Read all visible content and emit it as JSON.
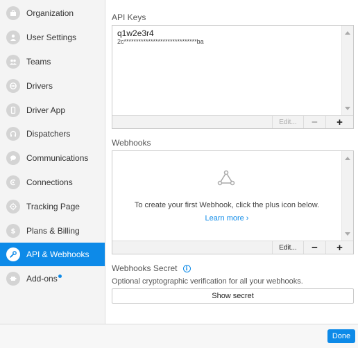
{
  "sidebar": {
    "items": [
      {
        "label": "Organization",
        "icon": "briefcase-icon"
      },
      {
        "label": "User Settings",
        "icon": "user-icon"
      },
      {
        "label": "Teams",
        "icon": "team-icon"
      },
      {
        "label": "Drivers",
        "icon": "steering-wheel-icon"
      },
      {
        "label": "Driver App",
        "icon": "phone-icon"
      },
      {
        "label": "Dispatchers",
        "icon": "headset-icon"
      },
      {
        "label": "Communications",
        "icon": "chat-bubble-icon"
      },
      {
        "label": "Connections",
        "icon": "connection-icon"
      },
      {
        "label": "Tracking Page",
        "icon": "crosshair-icon"
      },
      {
        "label": "Plans & Billing",
        "icon": "dollar-icon"
      },
      {
        "label": "API & Webhooks",
        "icon": "wrench-icon",
        "active": true
      },
      {
        "label": "Add-ons",
        "icon": "plugin-icon",
        "badge": true
      }
    ]
  },
  "api_keys": {
    "title": "API Keys",
    "keys": [
      {
        "name": "q1w2e3r4",
        "masked": "2c******************************ba"
      }
    ],
    "toolbar": {
      "edit": "Edit...",
      "minus": "−",
      "plus": "+"
    }
  },
  "webhooks": {
    "title": "Webhooks",
    "empty_text": "To create your first Webhook, click the plus icon below.",
    "learn_more": "Learn more ›",
    "toolbar": {
      "edit": "Edit...",
      "minus": "−",
      "plus": "+"
    }
  },
  "webhooks_secret": {
    "title": "Webhooks Secret",
    "info": "i",
    "description": "Optional cryptographic verification for all your webhooks.",
    "button": "Show secret"
  },
  "footer": {
    "done": "Done"
  },
  "colors": {
    "accent": "#0d8ae8",
    "sidebar_bg": "#f4f4f4"
  }
}
